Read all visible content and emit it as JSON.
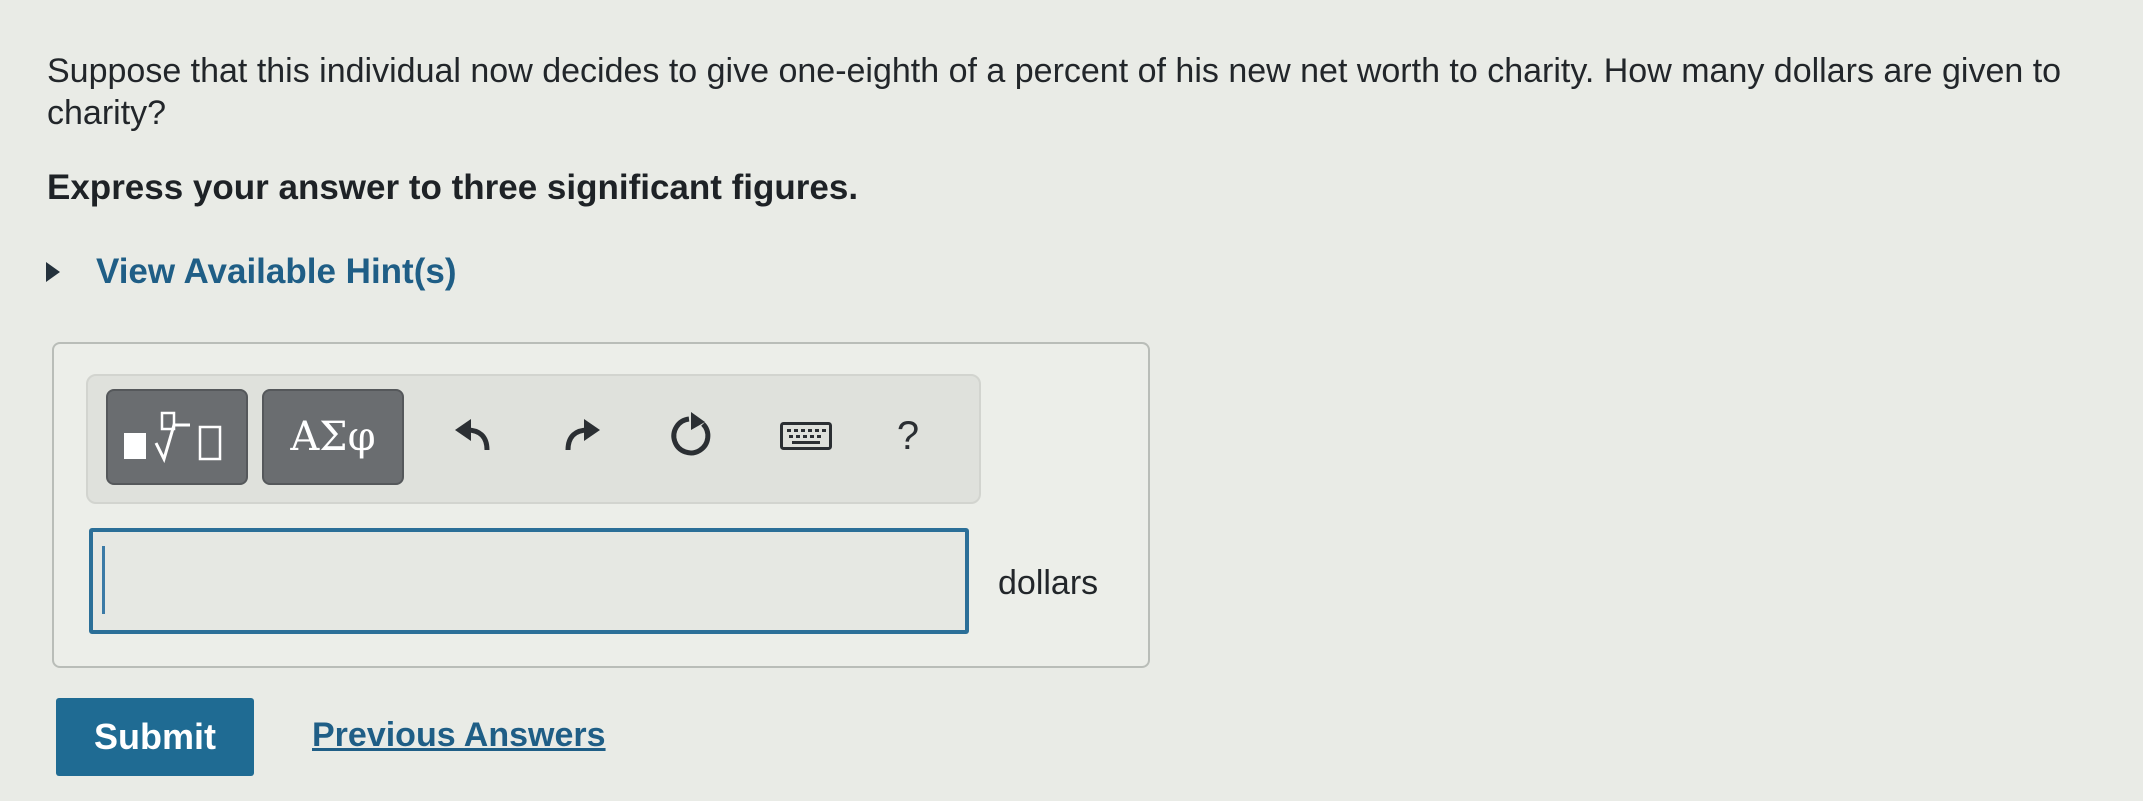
{
  "question": {
    "text": "Suppose that this individual now decides to give one-eighth of a percent of his new net worth to charity. How many dollars are given to charity?",
    "instruction": "Express your answer to three significant figures."
  },
  "hints": {
    "label": "View Available Hint(s)"
  },
  "toolbar": {
    "templates_icon": "fraction-root-template-icon",
    "symbols_label": "ΑΣφ",
    "undo_icon": "undo-icon",
    "redo_icon": "redo-icon",
    "reset_icon": "reset-icon",
    "keyboard_icon": "keyboard-icon",
    "help_label": "?"
  },
  "answer": {
    "value": "",
    "unit": "dollars"
  },
  "actions": {
    "submit_label": "Submit",
    "previous_answers_label": "Previous Answers"
  },
  "colors": {
    "accent": "#1f6b93",
    "link": "#1f5e86",
    "background": "#e9ebe6"
  }
}
